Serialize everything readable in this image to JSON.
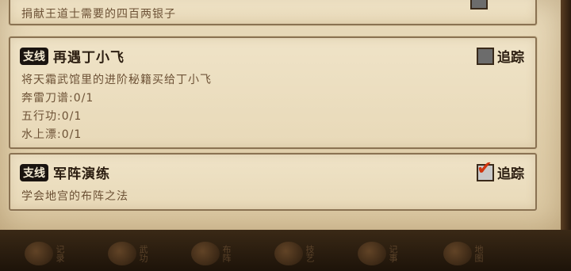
{
  "quests": [
    {
      "desc_lines": [
        "捐献王道士需要的四百两银子"
      ]
    },
    {
      "badge": "支线",
      "title": "再遇丁小飞",
      "track_label": "追踪",
      "tracked": false,
      "desc_lines": [
        "将天霜武馆里的进阶秘籍买给丁小飞",
        "奔雷刀谱:0/1",
        "五行功:0/1",
        "水上漂:0/1"
      ]
    },
    {
      "badge": "支线",
      "title": "军阵演练",
      "track_label": "追踪",
      "tracked": true,
      "desc_lines": [
        "学会地宫的布阵之法"
      ]
    }
  ],
  "nav": [
    {
      "icon": "orb-icon",
      "label": "记录"
    },
    {
      "icon": "books-icon",
      "label": "武功"
    },
    {
      "icon": "bagua-icon",
      "label": "布阵"
    },
    {
      "icon": "bowl-icon",
      "label": "技艺"
    },
    {
      "icon": "scroll-icon",
      "label": "记事"
    },
    {
      "icon": "map-icon",
      "label": "地图"
    }
  ]
}
